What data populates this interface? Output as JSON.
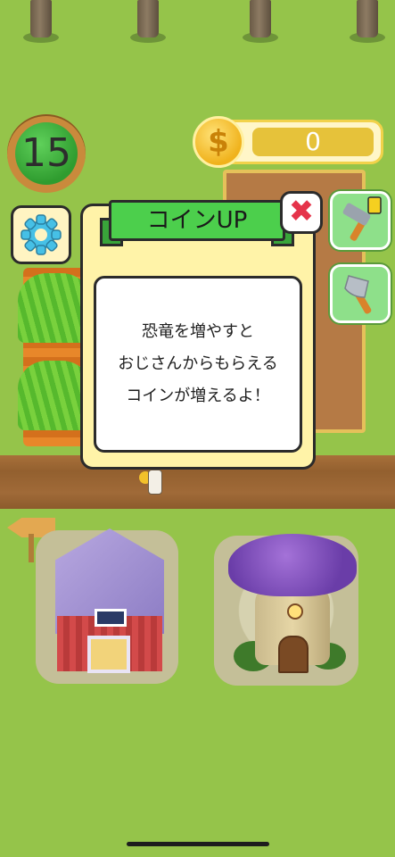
{
  "hud": {
    "level": "15",
    "coins": "0",
    "coin_symbol": "$"
  },
  "dialog": {
    "title": "コインUP",
    "message": "恐竜を増やすと\nおじさんからもらえる\nコインが増えるよ！",
    "close_symbol": "✖"
  },
  "icons": {
    "settings": "gear-icon",
    "hammer": "hammer-icon",
    "axe": "axe-icon",
    "coin": "coin-icon",
    "close": "close-icon",
    "arrow": "left-arrow-sign-icon"
  },
  "colors": {
    "grass": "#95c44a",
    "dialog_bg": "#fff3a8",
    "ribbon": "#4ccf4c",
    "coin_track": "#e6c23a",
    "close_x": "#e5334a"
  }
}
